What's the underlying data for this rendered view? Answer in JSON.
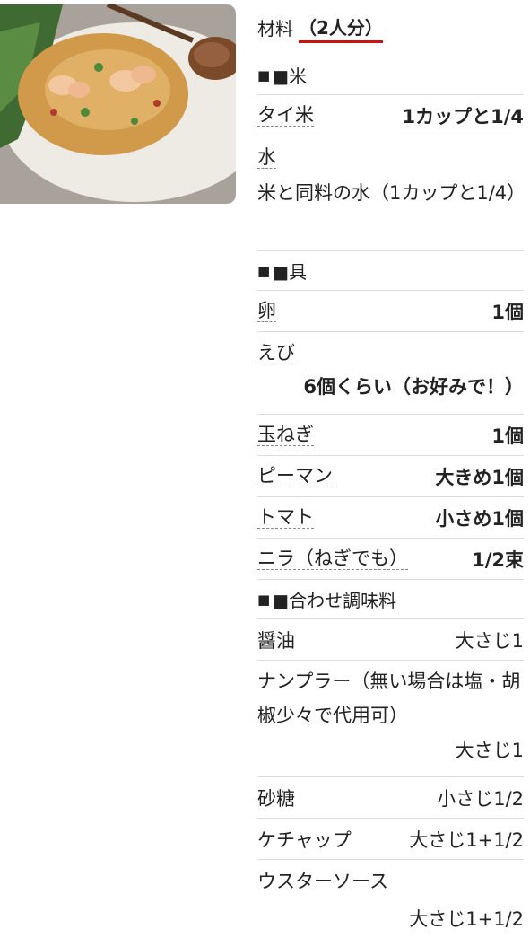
{
  "header": {
    "title": "材料",
    "servings": "（2人分）"
  },
  "sections": {
    "rice": {
      "heading": "■米",
      "items": {
        "thai_rice": {
          "name": "タイ米",
          "amount": "1カップと1/4"
        },
        "water": {
          "name": "水",
          "amount": "米と同料の水（1カップと1/4）"
        }
      }
    },
    "ingredients": {
      "heading": "■具",
      "items": {
        "egg": {
          "name": "卵",
          "amount": "1個"
        },
        "shrimp": {
          "name": "えび",
          "amount": "6個くらい（お好みで！）"
        },
        "onion": {
          "name": "玉ねぎ",
          "amount": "1個"
        },
        "pepper": {
          "name": "ピーマン",
          "amount": "大きめ1個"
        },
        "tomato": {
          "name": "トマト",
          "amount": "小さめ1個"
        },
        "chives": {
          "name": "ニラ（ねぎでも）",
          "amount": "1/2束"
        }
      }
    },
    "seasoning": {
      "heading": "■合わせ調味料",
      "items": {
        "soy": {
          "name": "醤油",
          "amount": "大さじ1"
        },
        "fish_sauce": {
          "name": "ナンプラー（無い場合は塩・胡椒少々で代用可）",
          "amount": "大さじ1"
        },
        "sugar": {
          "name": "砂糖",
          "amount": "小さじ1/2"
        },
        "ketchup": {
          "name": "ケチャップ",
          "amount": "大さじ1+1/2"
        },
        "worcester": {
          "name": "ウスターソース",
          "amount": "大さじ1+1/2"
        }
      }
    }
  },
  "icons": {
    "bullet": "square-bullet-icon"
  },
  "colors": {
    "underline": "#cc1111",
    "divider": "#dddddd"
  }
}
